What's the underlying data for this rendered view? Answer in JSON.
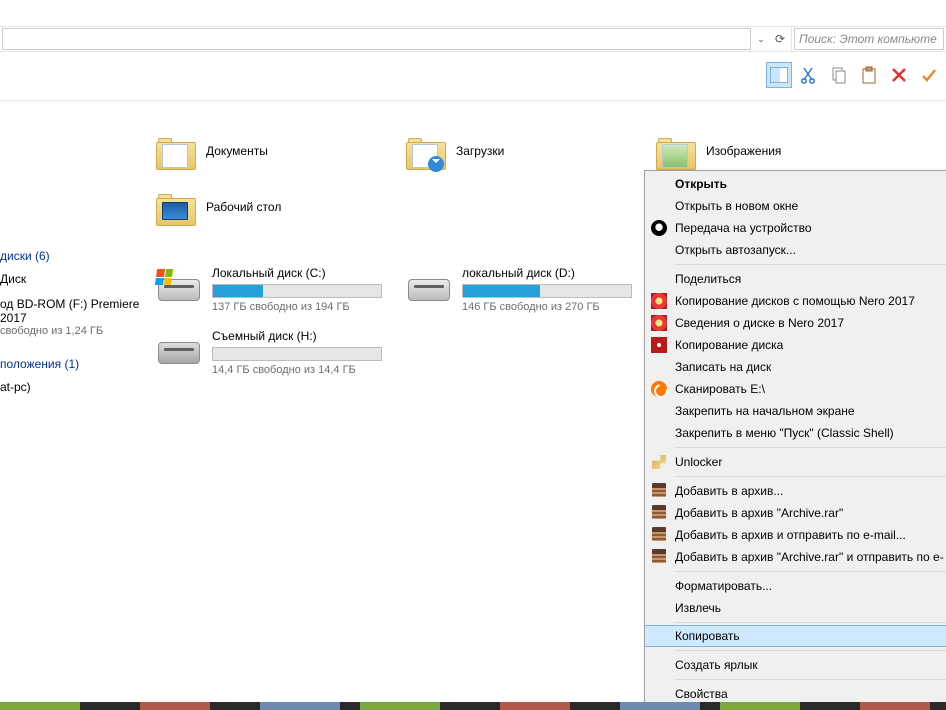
{
  "addressbar": {
    "dropdown_glyph": "⌄",
    "refresh_glyph": "⟳"
  },
  "search": {
    "placeholder": "Поиск: Этот компьюте"
  },
  "folders": [
    {
      "name": "Документы",
      "kind": "docs"
    },
    {
      "name": "Загрузки",
      "kind": "downloads"
    },
    {
      "name": "Изображения",
      "kind": "pictures"
    },
    {
      "name": "Рабочий стол",
      "kind": "desktop"
    }
  ],
  "sections": {
    "drives": "диски (6)",
    "network": "положения (1)"
  },
  "side": {
    "disk": "Диск",
    "bd": {
      "line1": "од BD-ROM (F:) Premiere",
      "line2": "2017",
      "free": "свободно из 1,24 ГБ"
    },
    "net": "at-pc)"
  },
  "drives": [
    {
      "name": "Локальный диск (C:)",
      "free": "137 ГБ свободно из 194 ГБ",
      "fill_pct": 30,
      "kind": "system"
    },
    {
      "name": "локальный диск  (D:)",
      "free": "146 ГБ свободно из 270 ГБ",
      "fill_pct": 46,
      "kind": "hdd"
    },
    {
      "name": "Съемный диск (H:)",
      "free": "14,4 ГБ свободно из 14,4 ГБ",
      "fill_pct": 0,
      "kind": "removable"
    }
  ],
  "context_menu": [
    {
      "label": "Открыть",
      "bold": true
    },
    {
      "label": "Открыть в новом окне"
    },
    {
      "label": "Передача на устройство",
      "icon": "dev"
    },
    {
      "label": "Открыть автозапуск..."
    },
    {
      "sep": true
    },
    {
      "label": "Поделиться"
    },
    {
      "label": "Копирование дисков с помощью Nero 2017",
      "icon": "nero"
    },
    {
      "label": "Сведения о диске в Nero 2017",
      "icon": "nero"
    },
    {
      "label": "Копирование диска",
      "icon": "nerodisc"
    },
    {
      "label": "Записать на диск"
    },
    {
      "label": "Сканировать E:\\",
      "icon": "avast"
    },
    {
      "label": "Закрепить на начальном экране"
    },
    {
      "label": "Закрепить в меню \"Пуск\" (Classic Shell)"
    },
    {
      "sep": true
    },
    {
      "label": "Unlocker",
      "icon": "key"
    },
    {
      "sep": true
    },
    {
      "label": "Добавить в архив...",
      "icon": "rar"
    },
    {
      "label": "Добавить в архив \"Archive.rar\"",
      "icon": "rar"
    },
    {
      "label": "Добавить в архив и отправить по e-mail...",
      "icon": "rar"
    },
    {
      "label": "Добавить в архив \"Archive.rar\" и отправить по e-",
      "icon": "rar"
    },
    {
      "sep": true
    },
    {
      "label": "Форматировать..."
    },
    {
      "label": "Извлечь"
    },
    {
      "sep": true
    },
    {
      "label": "Копировать",
      "hover": true
    },
    {
      "sep": true
    },
    {
      "label": "Создать ярлык"
    },
    {
      "sep": true
    },
    {
      "label": "Свойства"
    }
  ]
}
